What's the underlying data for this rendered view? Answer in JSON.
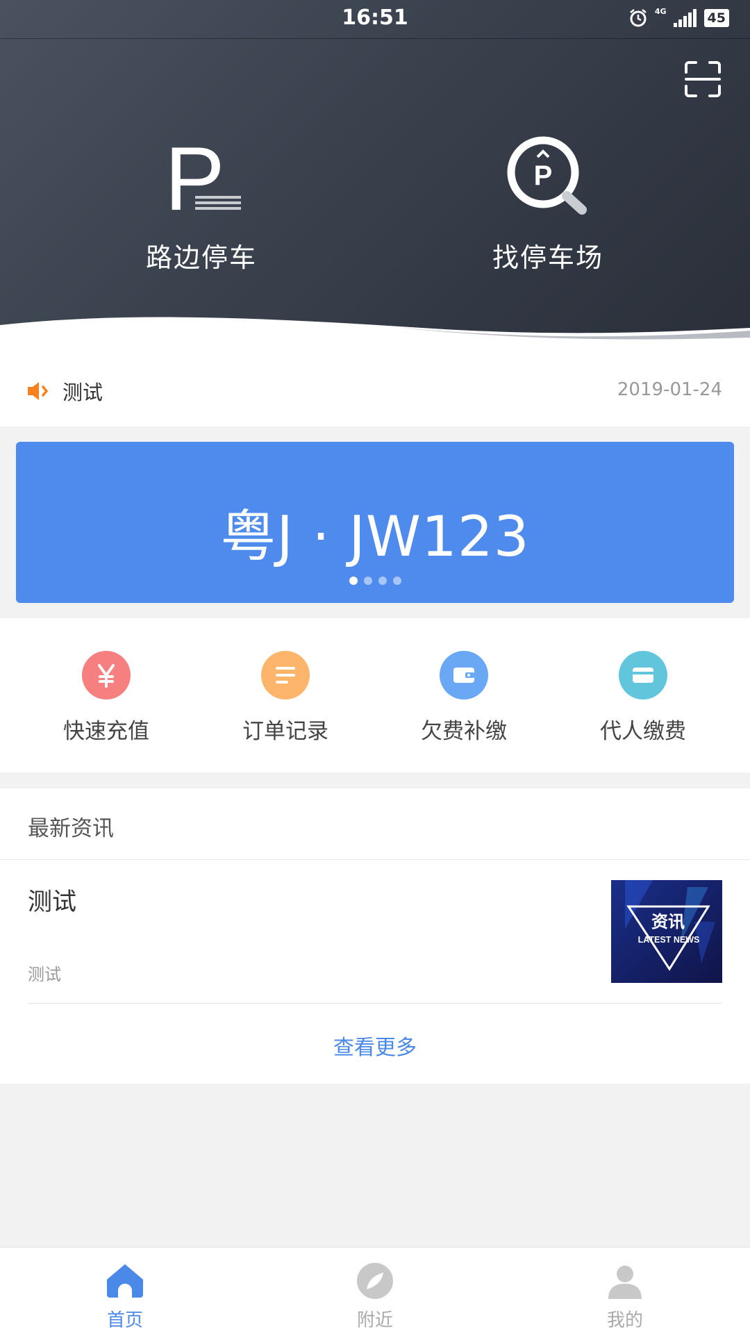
{
  "status_bar": {
    "time": "16:51",
    "network": "4G",
    "battery": "45"
  },
  "header": {
    "features": [
      {
        "label": "路边停车",
        "icon": "parking-p-icon"
      },
      {
        "label": "找停车场",
        "icon": "find-parking-icon"
      }
    ]
  },
  "notice": {
    "text": "测试",
    "date": "2019-01-24"
  },
  "banner": {
    "plate": "粤J · JW123",
    "page_count": 4,
    "active_index": 0
  },
  "actions": [
    {
      "label": "快速充值",
      "icon": "yen-icon",
      "color": "#f67f7f"
    },
    {
      "label": "订单记录",
      "icon": "list-icon",
      "color": "#fdb56b"
    },
    {
      "label": "欠费补缴",
      "icon": "wallet-icon",
      "color": "#6aa7f5"
    },
    {
      "label": "代人缴费",
      "icon": "card-icon",
      "color": "#61c6dc"
    }
  ],
  "news": {
    "section_title": "最新资讯",
    "item": {
      "title": "测试",
      "desc": "测试",
      "thumb_text": "资讯",
      "thumb_subtext": "LATEST NEWS"
    },
    "more_label": "查看更多"
  },
  "tabbar": {
    "tabs": [
      {
        "label": "首页",
        "icon": "home-icon",
        "active": true
      },
      {
        "label": "附近",
        "icon": "compass-icon",
        "active": false
      },
      {
        "label": "我的",
        "icon": "user-icon",
        "active": false
      }
    ]
  },
  "colors": {
    "accent": "#4a89e8",
    "banner": "#4f8bec",
    "notice_icon": "#f5821f"
  }
}
